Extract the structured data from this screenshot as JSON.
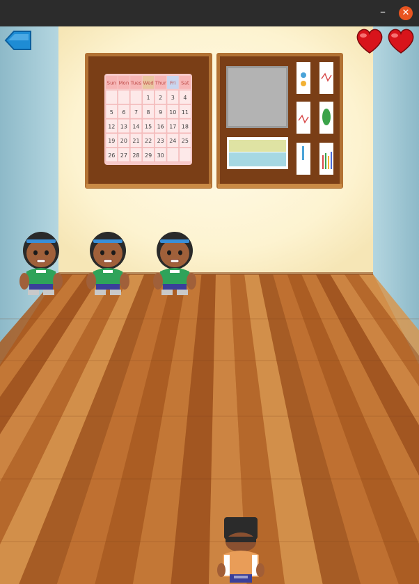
{
  "window": {
    "minimize_glyph": "–",
    "close_glyph": "✕"
  },
  "hud": {
    "back_icon": "arrow-left-icon",
    "lives": 2,
    "heart_color": "#d8141b"
  },
  "calendar": {
    "days": [
      "Sun",
      "Mon",
      "Tues",
      "Wed",
      "Thur",
      "Fri",
      "Sat"
    ],
    "weeks": [
      [
        "",
        "",
        "",
        "1",
        "2",
        "3",
        "4"
      ],
      [
        "5",
        "6",
        "7",
        "8",
        "9",
        "10",
        "11"
      ],
      [
        "12",
        "13",
        "14",
        "15",
        "16",
        "17",
        "18"
      ],
      [
        "19",
        "20",
        "21",
        "22",
        "23",
        "24",
        "25"
      ],
      [
        "26",
        "27",
        "28",
        "29",
        "30",
        "",
        ""
      ]
    ]
  },
  "colors": {
    "wall": "#fdf3d0",
    "side_wall": "#9fc6d3",
    "floor": "#b8692a",
    "board_frame": "#b27234",
    "cork": "#7a3e16",
    "kid_shirt": "#2fa35a",
    "player_hat": "#2b2b2b"
  }
}
